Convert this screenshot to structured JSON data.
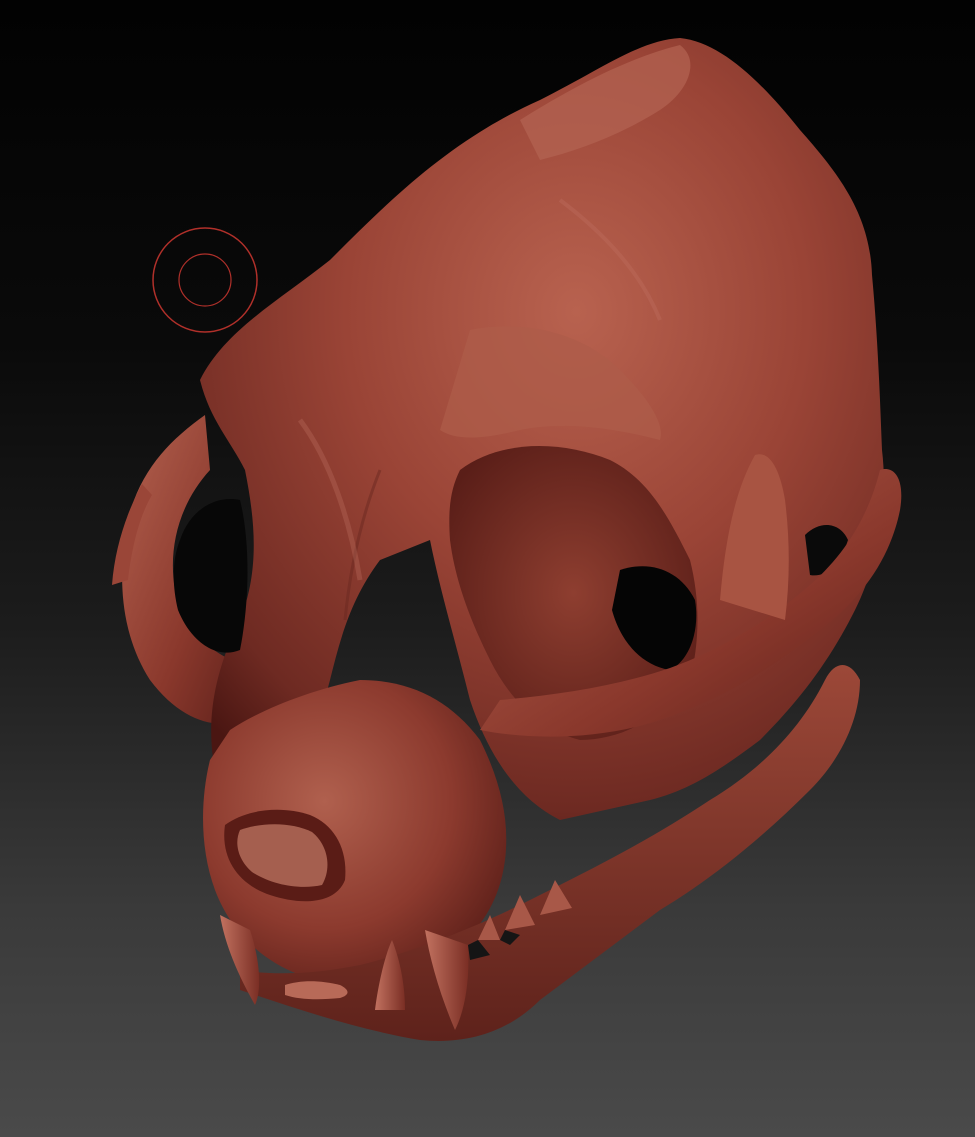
{
  "viewport": {
    "background_top": "#020202",
    "background_bottom": "#4a4a4a"
  },
  "model": {
    "subject": "cat-skull-sculpt",
    "material_color": "#8e3a30",
    "highlight_color": "#c06a58",
    "shadow_color": "#4a1612"
  },
  "brush_cursor": {
    "icon": "brush-cursor-icon",
    "ring_color": "#b0302a"
  }
}
